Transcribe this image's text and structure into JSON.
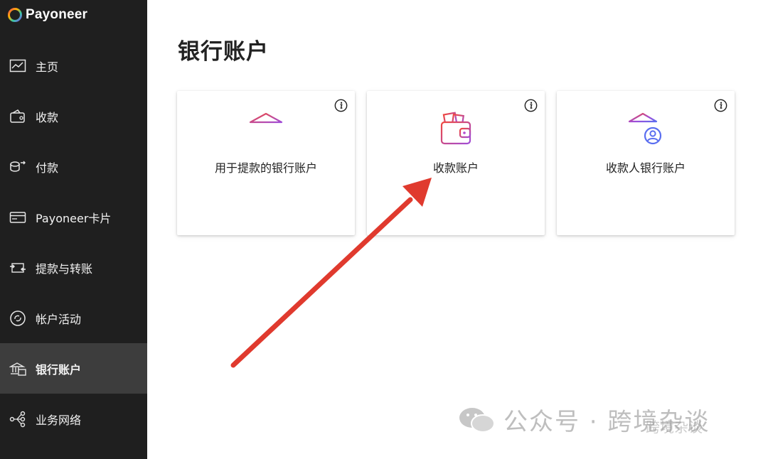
{
  "brand": {
    "name": "Payoneer"
  },
  "sidebar": {
    "items": [
      {
        "label": "主页",
        "icon": "dashboard-chart-icon"
      },
      {
        "label": "收款",
        "icon": "wallet-receive-icon"
      },
      {
        "label": "付款",
        "icon": "coins-send-icon"
      },
      {
        "label": "Payoneer卡片",
        "icon": "card-icon"
      },
      {
        "label": "提款与转账",
        "icon": "transfer-icon"
      },
      {
        "label": "帐户活动",
        "icon": "activity-icon"
      },
      {
        "label": "银行账户",
        "icon": "bank-icon",
        "active": true
      },
      {
        "label": "业务网络",
        "icon": "network-icon"
      }
    ]
  },
  "main": {
    "title": "银行账户",
    "cards": [
      {
        "label": "用于提款的银行账户",
        "icon": "bank-building-icon"
      },
      {
        "label": "收款账户",
        "icon": "wallet-icon"
      },
      {
        "label": "收款人银行账户",
        "icon": "bank-person-icon"
      }
    ]
  },
  "watermark": {
    "text": "公众号 · 跨境杂谈",
    "sub": "跨境杂谈"
  },
  "colors": {
    "sidebar": "#1f1f1f",
    "sidebar_active": "#3d3d3d",
    "accent_start": "#e8424d",
    "accent_end": "#7a5cf0",
    "arrow": "#e03a2e"
  }
}
